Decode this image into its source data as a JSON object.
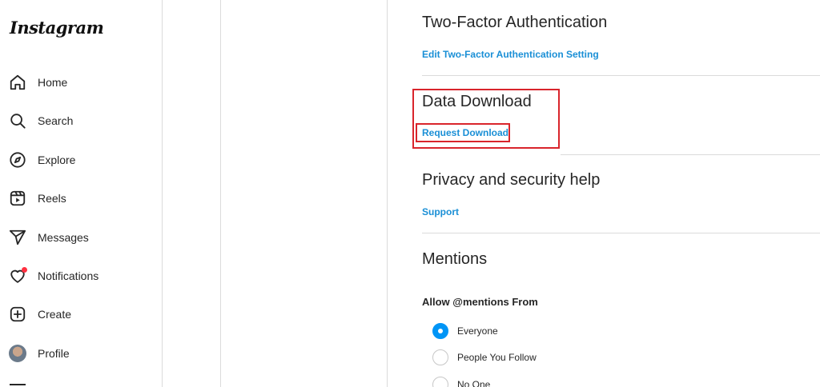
{
  "app": {
    "logo_text": "Instagram"
  },
  "sidebar": {
    "items": [
      {
        "label": "Home",
        "icon": "home-icon"
      },
      {
        "label": "Search",
        "icon": "search-icon"
      },
      {
        "label": "Explore",
        "icon": "compass-icon"
      },
      {
        "label": "Reels",
        "icon": "reels-icon"
      },
      {
        "label": "Messages",
        "icon": "send-icon"
      },
      {
        "label": "Notifications",
        "icon": "heart-icon"
      },
      {
        "label": "Create",
        "icon": "plus-square-icon"
      },
      {
        "label": "Profile",
        "icon": "avatar"
      }
    ]
  },
  "settings": {
    "two_factor": {
      "title": "Two-Factor Authentication",
      "link": "Edit Two-Factor Authentication Setting"
    },
    "data_download": {
      "title": "Data Download",
      "link": "Request Download"
    },
    "privacy_help": {
      "title": "Privacy and security help",
      "link": "Support"
    },
    "mentions": {
      "title": "Mentions",
      "subheading": "Allow @mentions From",
      "options": [
        {
          "label": "Everyone",
          "checked": true
        },
        {
          "label": "People You Follow",
          "checked": false
        },
        {
          "label": "No One",
          "checked": false
        }
      ]
    }
  },
  "colors": {
    "link": "#1a8fd6",
    "highlight": "#d9252c",
    "radio_selected": "#0095f6",
    "notification_dot": "#ff3040"
  }
}
